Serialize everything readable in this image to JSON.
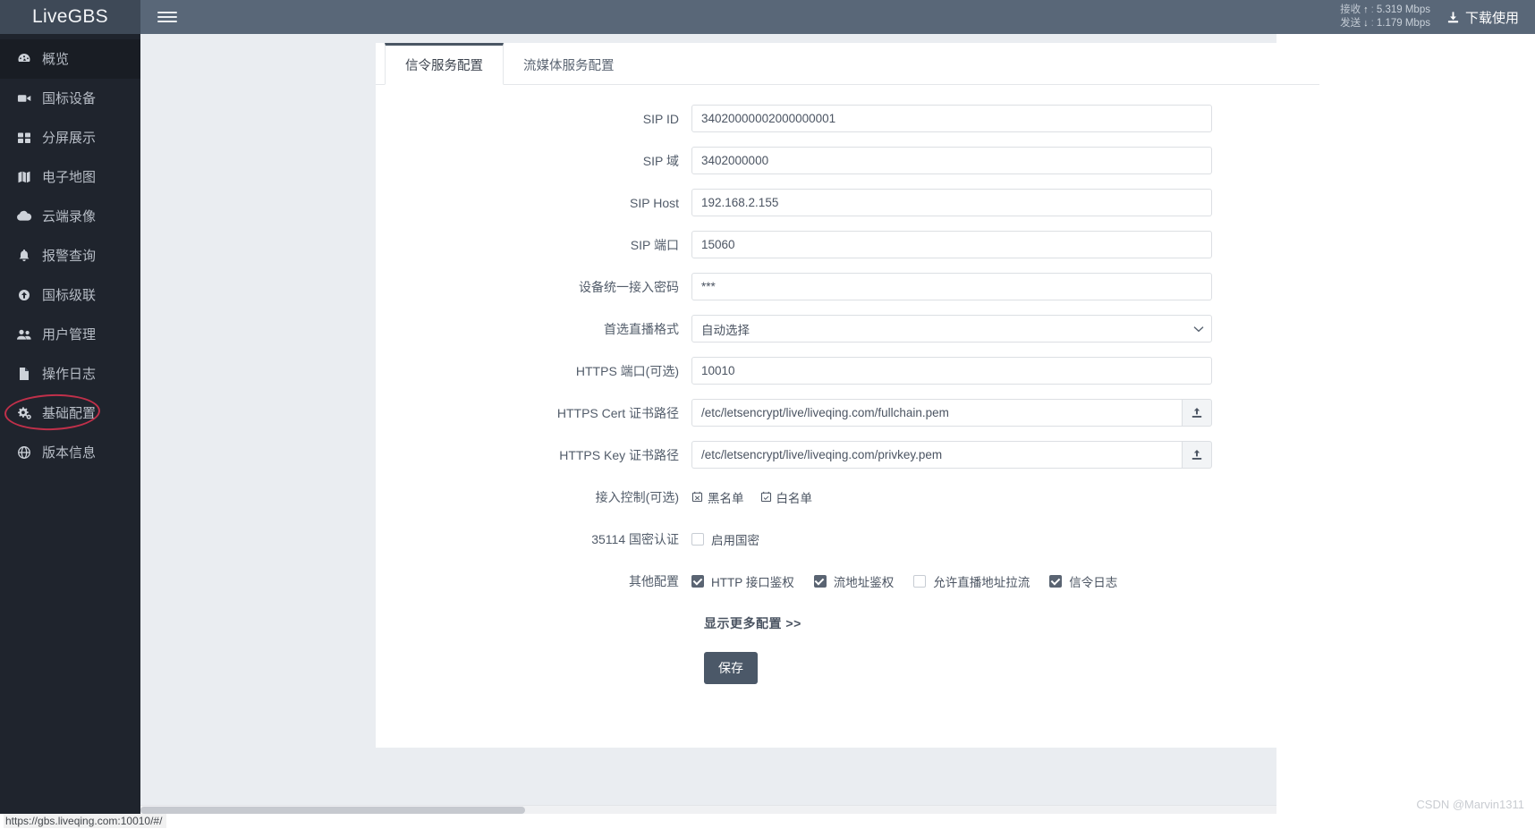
{
  "brand": {
    "name": "LiveGBS"
  },
  "sidebar": {
    "items": [
      {
        "label": "概览",
        "icon": "dashboard-icon",
        "active": true
      },
      {
        "label": "国标设备",
        "icon": "video-camera-icon",
        "active": false
      },
      {
        "label": "分屏展示",
        "icon": "grid-icon",
        "active": false
      },
      {
        "label": "电子地图",
        "icon": "map-icon",
        "active": false
      },
      {
        "label": "云端录像",
        "icon": "cloud-icon",
        "active": false
      },
      {
        "label": "报警查询",
        "icon": "bell-icon",
        "active": false
      },
      {
        "label": "国标级联",
        "icon": "cloud-upload-icon",
        "active": false
      },
      {
        "label": "用户管理",
        "icon": "users-icon",
        "active": false
      },
      {
        "label": "操作日志",
        "icon": "document-icon",
        "active": false
      },
      {
        "label": "基础配置",
        "icon": "gears-icon",
        "active": false,
        "highlighted": true
      },
      {
        "label": "版本信息",
        "icon": "globe-icon",
        "active": false
      }
    ]
  },
  "topbar": {
    "menu_icon": "hamburger-icon",
    "network": {
      "receive_label": "接收",
      "receive_arrow": "↑",
      "receive_value": "5.319 Mbps",
      "send_label": "发送",
      "send_arrow": "↓",
      "send_value": "1.179 Mbps",
      "separator": ":"
    },
    "download": {
      "label": "下载使用",
      "icon": "download-icon"
    }
  },
  "tabs": [
    {
      "label": "信令服务配置",
      "active": true
    },
    {
      "label": "流媒体服务配置",
      "active": false
    }
  ],
  "form": {
    "sip_id": {
      "label": "SIP ID",
      "value": "34020000002000000001",
      "placeholder": ""
    },
    "sip_domain": {
      "label": "SIP 域",
      "value": "3402000000",
      "placeholder": ""
    },
    "sip_host": {
      "label": "SIP Host",
      "value": "192.168.2.155",
      "placeholder": ""
    },
    "sip_port": {
      "label": "SIP 端口",
      "value": "15060",
      "placeholder": ""
    },
    "device_password": {
      "label": "设备统一接入密码",
      "value": "***",
      "placeholder": ""
    },
    "live_format": {
      "label": "首选直播格式",
      "value": "自动选择",
      "options": [
        "自动选择"
      ]
    },
    "https_port": {
      "label": "HTTPS 端口(可选)",
      "value": "10010",
      "placeholder": ""
    },
    "https_cert": {
      "label": "HTTPS Cert 证书路径",
      "value": "/etc/letsencrypt/live/liveqing.com/fullchain.pem",
      "upload_icon": "upload-icon"
    },
    "https_key": {
      "label": "HTTPS Key 证书路径",
      "value": "/etc/letsencrypt/live/liveqing.com/privkey.pem",
      "upload_icon": "upload-icon"
    },
    "access_control": {
      "label": "接入控制(可选)",
      "blacklist": {
        "label": "黑名单",
        "icon": "list-icon"
      },
      "whitelist": {
        "label": "白名单",
        "icon": "list-icon"
      }
    },
    "gm_auth": {
      "label": "35114 国密认证",
      "checkbox": {
        "label": "启用国密",
        "checked": false
      }
    },
    "other_config": {
      "label": "其他配置",
      "items": [
        {
          "label": "HTTP 接口鉴权",
          "checked": true
        },
        {
          "label": "流地址鉴权",
          "checked": true
        },
        {
          "label": "允许直播地址拉流",
          "checked": false
        },
        {
          "label": "信令日志",
          "checked": true
        }
      ]
    },
    "more_link": "显示更多配置  >>",
    "save_button": "保存"
  },
  "statusbar": {
    "url": "https://gbs.liveqing.com:10010/#/"
  },
  "watermark": "CSDN @Marvin1311",
  "colors": {
    "sidebar_bg": "#1f242d",
    "brand_bg": "#3e4957",
    "topbar_bg": "#596778",
    "content_bg": "#eaedf1",
    "accent": "#4b5868",
    "highlight_ring": "#c0304a"
  }
}
